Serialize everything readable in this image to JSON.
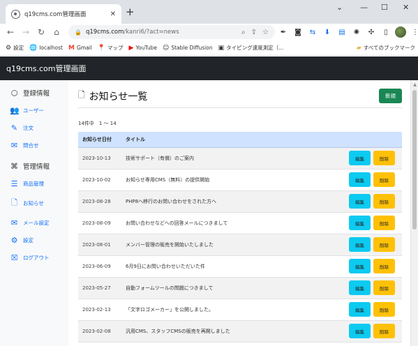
{
  "browser": {
    "tab_title": "q19cms.com管理画面",
    "tab_close": "✕",
    "new_tab": "+",
    "window_controls": [
      "⌄",
      "—",
      "☐",
      "✕"
    ],
    "nav": {
      "back": "←",
      "forward": "→",
      "reload": "↻",
      "home": "⌂"
    },
    "url_host": "q19cms.com",
    "url_path": "/kanri6/?act=news",
    "bookmarks": [
      {
        "icon": "⚙",
        "label": "設定"
      },
      {
        "icon": "🌐",
        "label": "localhost"
      },
      {
        "icon": "M",
        "label": "Gmail",
        "color": "#ea4335"
      },
      {
        "icon": "📍",
        "label": "マップ"
      },
      {
        "icon": "▶",
        "label": "YouTube",
        "color": "#ff0000"
      },
      {
        "icon": "☺",
        "label": "Stable Diffusion"
      },
      {
        "icon": "▣",
        "label": "タイピング速度測定（..."
      }
    ],
    "all_bookmarks": "すべてのブックマーク"
  },
  "app": {
    "title": "q19cms.com管理画面"
  },
  "sidebar": {
    "section1": "登録情報",
    "items1": [
      {
        "icon": "👥",
        "label": "ユーザー"
      },
      {
        "icon": "✎",
        "label": "注文"
      },
      {
        "icon": "✉",
        "label": "問合せ"
      }
    ],
    "section2": "管理情報",
    "items2": [
      {
        "icon": "☰",
        "label": "商品管理"
      },
      {
        "icon": "🗋",
        "label": "お知らせ"
      },
      {
        "icon": "✉",
        "label": "メール設定"
      },
      {
        "icon": "⚙",
        "label": "設定"
      },
      {
        "icon": "☒",
        "label": "ログアウト"
      }
    ]
  },
  "main": {
    "page_title": "お知らせ一覧",
    "new_button": "新規",
    "count_text": "14件中　1 ～ 14",
    "columns": [
      "お知らせ日付",
      "タイトル",
      ""
    ],
    "edit_label": "編集",
    "delete_label": "削除",
    "rows": [
      {
        "date": "2023-10-13",
        "title": "技術サポート（有償）のご案内"
      },
      {
        "date": "2023-10-02",
        "title": "お知らせ専用CMS（無料）の提供開始"
      },
      {
        "date": "2023-08-28",
        "title": "PHP8へ移行のお問い合わせをされた方へ"
      },
      {
        "date": "2023-08-09",
        "title": "お問い合わせなどへの回答メールにつきまして"
      },
      {
        "date": "2023-08-01",
        "title": "メンバー管理の販売を開始いたしました"
      },
      {
        "date": "2023-06-09",
        "title": "6月9日にお問い合わせいただいた件"
      },
      {
        "date": "2023-05-27",
        "title": "自動フォームツールの問題につきまして"
      },
      {
        "date": "2023-02-13",
        "title": "「文字ロゴメーカー」を公開しました。"
      },
      {
        "date": "2023-02-08",
        "title": "汎用CMS、スタッフCMSの販売を再開しました"
      }
    ]
  }
}
